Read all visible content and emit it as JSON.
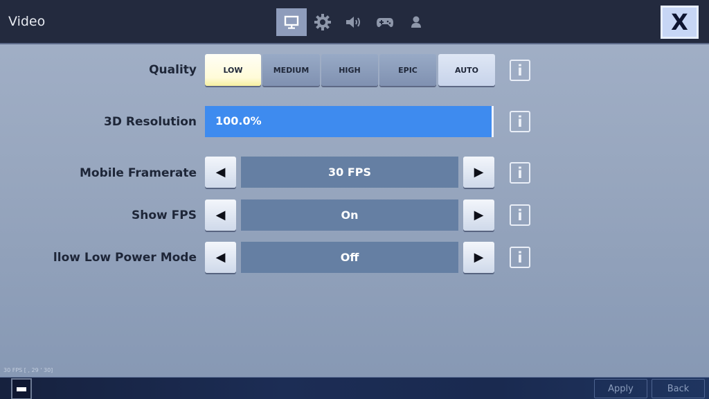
{
  "header": {
    "title": "Video",
    "tabs": [
      {
        "name": "video",
        "icon": "monitor-icon",
        "active": true
      },
      {
        "name": "game",
        "icon": "gear-icon",
        "active": false
      },
      {
        "name": "audio",
        "icon": "speaker-icon",
        "active": false
      },
      {
        "name": "controller",
        "icon": "gamepad-icon",
        "active": false
      },
      {
        "name": "account",
        "icon": "user-icon",
        "active": false
      }
    ],
    "close_label": "X"
  },
  "settings": {
    "quality": {
      "label": "Quality",
      "options": [
        "LOW",
        "MEDIUM",
        "HIGH",
        "EPIC",
        "AUTO"
      ],
      "selected": "LOW"
    },
    "resolution": {
      "label": "3D Resolution",
      "value_text": "100.0%",
      "value_percent": 100
    },
    "framerate": {
      "label": "Mobile Framerate",
      "value": "30 FPS"
    },
    "show_fps": {
      "label": "Show FPS",
      "value": "On"
    },
    "low_power": {
      "label": "llow Low Power Mode",
      "value": "Off"
    },
    "arrow_left": "◀",
    "arrow_right": "▶",
    "info_glyph": "i"
  },
  "overlay": {
    "fps_counter": "30 FPS [ , 29 ' 30]"
  },
  "footer": {
    "apply_label": "Apply",
    "back_label": "Back"
  }
}
